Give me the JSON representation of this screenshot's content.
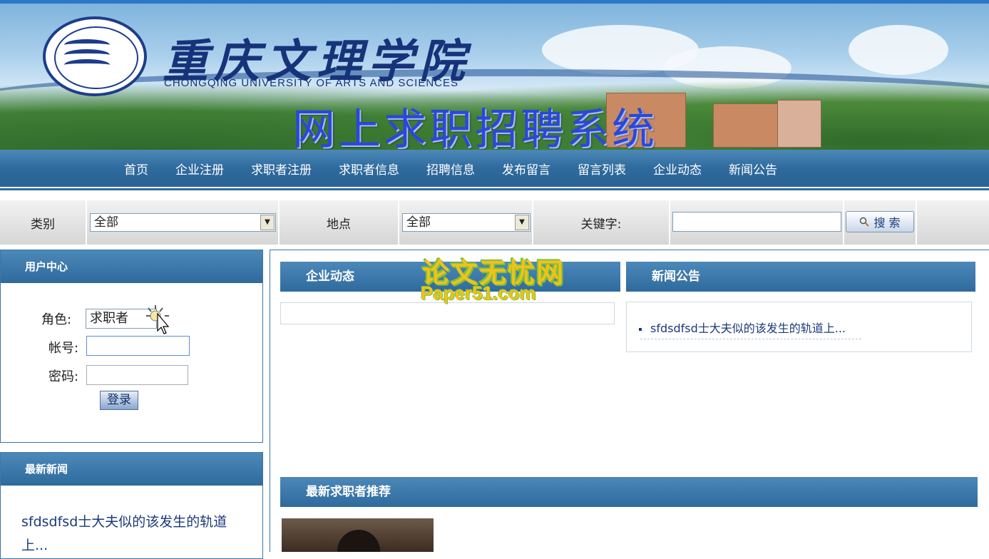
{
  "banner": {
    "school_cn": "重庆文理学院",
    "school_en": "CHONGQING UNIVERSITY OF ARTS AND SCIENCES",
    "system_title": "网上求职招聘系统",
    "logo": "university-seal"
  },
  "nav": {
    "items": [
      "首页",
      "企业注册",
      "求职者注册",
      "求职者信息",
      "招聘信息",
      "发布留言",
      "留言列表",
      "企业动态",
      "新闻公告"
    ]
  },
  "search": {
    "category_label": "类别",
    "category_value": "全部",
    "location_label": "地点",
    "location_value": "全部",
    "keyword_label": "关键字:",
    "keyword_value": "",
    "button_label": "搜 索",
    "button_icon": "magnifier-icon"
  },
  "user_center": {
    "title": "用户中心",
    "role_label": "角色:",
    "role_value": "求职者",
    "account_label": "帐号:",
    "account_value": "",
    "password_label": "密码:",
    "password_value": "",
    "login_label": "登录"
  },
  "latest_news": {
    "title": "最新新闻",
    "item": "sfdsdfsd士大夫似的该发生的轨道上..."
  },
  "main": {
    "company_news_title": "企业动态",
    "announcements_title": "新闻公告",
    "announcement_item": "sfdsdfsd士大夫似的该发生的轨道上...",
    "recommend_title": "最新求职者推荐"
  },
  "watermark": {
    "line1": "论文无忧网",
    "line2": "Paper51.com"
  },
  "colors": {
    "nav_blue": "#2f6a9d",
    "title_blue": "#2a48d8",
    "link_blue": "#1a3a7a"
  }
}
